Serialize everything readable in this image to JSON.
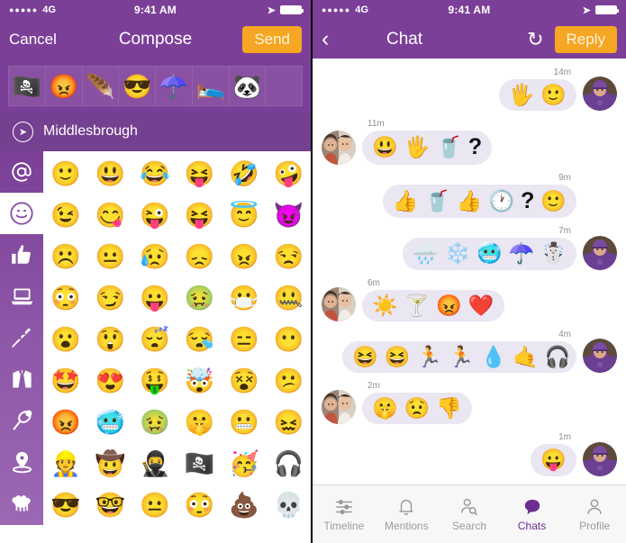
{
  "status_bar": {
    "signal_dots": "●●●●●",
    "carrier": "4G",
    "time": "9:41 AM",
    "location_icon": "location-arrow-icon",
    "battery_icon": "battery-full-icon"
  },
  "colors": {
    "brand_purple": "#7B3F98",
    "dark_purple": "#744090",
    "accent_orange": "#F5A623",
    "bubble": "#EAE6F2",
    "tab_active": "#6E2E91",
    "tab_inactive": "#9B9B9B"
  },
  "left_screen": {
    "nav": {
      "cancel_label": "Cancel",
      "title": "Compose",
      "send_label": "Send"
    },
    "compose_strip": {
      "emoji": [
        "🏴‍☠️",
        "😡",
        "🪶",
        "😎",
        "☂️",
        "🛌",
        "🐼",
        ""
      ],
      "names": [
        "pirate-face-emoji",
        "angry-face-emoji",
        "feather-emoji",
        "sunglasses-face-emoji",
        "umbrella-emoji",
        "person-in-bed-emoji",
        "panda-emoji",
        "empty-slot"
      ]
    },
    "location": {
      "icon": "navigation-arrow-icon",
      "name": "Middlesbrough"
    },
    "categories": [
      {
        "name": "recent-at-category",
        "icon": "at-icon",
        "glyph": "@",
        "active": false
      },
      {
        "name": "smileys-category",
        "icon": "heart-eyes-smiley-icon",
        "glyph": "☺",
        "active": true
      },
      {
        "name": "gestures-category",
        "icon": "thumbs-up-icon",
        "glyph": "👍",
        "active": false
      },
      {
        "name": "objects-category",
        "icon": "laptop-icon",
        "glyph": "💻",
        "active": false
      },
      {
        "name": "food-category",
        "icon": "pizza-icon",
        "glyph": "🍕",
        "active": false
      },
      {
        "name": "clothing-category",
        "icon": "shirt-icon",
        "glyph": "👕",
        "active": false
      },
      {
        "name": "sports-category",
        "icon": "tennis-racket-icon",
        "glyph": "🎾",
        "active": false
      },
      {
        "name": "places-category",
        "icon": "map-pin-icon",
        "glyph": "📍",
        "active": false
      },
      {
        "name": "animals-category",
        "icon": "sheep-icon",
        "glyph": "🐑",
        "active": false
      }
    ],
    "emoji_grid": [
      {
        "g": "🙂",
        "n": "slightly-smiling-face-emoji"
      },
      {
        "g": "😃",
        "n": "grinning-face-emoji"
      },
      {
        "g": "😂",
        "n": "tears-of-joy-emoji"
      },
      {
        "g": "😝",
        "n": "squinting-tongue-emoji"
      },
      {
        "g": "🤣",
        "n": "rolling-on-floor-laughing-emoji"
      },
      {
        "g": "🤪",
        "n": "wavy-mouth-face-emoji"
      },
      {
        "g": "😉",
        "n": "winking-face-emoji"
      },
      {
        "g": "😋",
        "n": "tongue-out-face-emoji"
      },
      {
        "g": "😜",
        "n": "winking-tongue-face-emoji"
      },
      {
        "g": "😝",
        "n": "closed-eyes-tongue-emoji"
      },
      {
        "g": "😇",
        "n": "halo-angel-face-emoji"
      },
      {
        "g": "😈",
        "n": "devil-horns-face-emoji"
      },
      {
        "g": "☹️",
        "n": "frowning-face-emoji"
      },
      {
        "g": "😐",
        "n": "neutral-face-emoji"
      },
      {
        "g": "😥",
        "n": "sad-tear-face-emoji"
      },
      {
        "g": "😞",
        "n": "disappointed-face-emoji"
      },
      {
        "g": "😠",
        "n": "angry-face-emoji"
      },
      {
        "g": "😒",
        "n": "unamused-face-emoji"
      },
      {
        "g": "😳",
        "n": "flushed-face-emoji"
      },
      {
        "g": "😏",
        "n": "smirking-drool-face-emoji"
      },
      {
        "g": "😛",
        "n": "tongue-sticking-out-emoji"
      },
      {
        "g": "🤢",
        "n": "vomiting-face-emoji"
      },
      {
        "g": "😷",
        "n": "face-with-medical-mask-emoji"
      },
      {
        "g": "🤐",
        "n": "zipper-mouth-face-emoji"
      },
      {
        "g": "😮",
        "n": "open-mouth-face-emoji"
      },
      {
        "g": "😲",
        "n": "astonished-face-emoji"
      },
      {
        "g": "😴",
        "n": "sleeping-face-emoji"
      },
      {
        "g": "😪",
        "n": "sleepy-face-emoji"
      },
      {
        "g": "😑",
        "n": "expressionless-face-emoji"
      },
      {
        "g": "😶",
        "n": "no-mouth-face-emoji"
      },
      {
        "g": "🤩",
        "n": "star-struck-face-emoji"
      },
      {
        "g": "😍",
        "n": "heart-eyes-face-emoji"
      },
      {
        "g": "🤑",
        "n": "money-mouth-face-emoji"
      },
      {
        "g": "🤯",
        "n": "mind-blown-face-emoji"
      },
      {
        "g": "😵",
        "n": "dizzy-face-emoji"
      },
      {
        "g": "😕",
        "n": "confused-face-emoji"
      },
      {
        "g": "😡",
        "n": "red-angry-face-emoji"
      },
      {
        "g": "🥶",
        "n": "cold-face-emoji"
      },
      {
        "g": "🤢",
        "n": "green-sick-face-emoji"
      },
      {
        "g": "🤫",
        "n": "shushing-face-emoji"
      },
      {
        "g": "😬",
        "n": "grimacing-face-emoji"
      },
      {
        "g": "😖",
        "n": "confounded-face-emoji"
      },
      {
        "g": "👷",
        "n": "construction-worker-emoji"
      },
      {
        "g": "🤠",
        "n": "cowboy-hat-face-emoji"
      },
      {
        "g": "🥷",
        "n": "ninja-emoji"
      },
      {
        "g": "🏴‍☠️",
        "n": "pirate-face-emoji"
      },
      {
        "g": "🥳",
        "n": "party-face-emoji"
      },
      {
        "g": "🎧",
        "n": "headphones-face-emoji"
      },
      {
        "g": "😎",
        "n": "sunglasses-face-emoji"
      },
      {
        "g": "🤓",
        "n": "nerd-face-emoji"
      },
      {
        "g": "😐",
        "n": "blank-face-emoji"
      },
      {
        "g": "😳",
        "n": "blushing-face-emoji"
      },
      {
        "g": "💩",
        "n": "pile-of-poo-emoji"
      },
      {
        "g": "💀",
        "n": "skull-emoji"
      }
    ]
  },
  "right_screen": {
    "nav": {
      "back_icon": "chevron-left-icon",
      "title": "Chat",
      "refresh_icon": "refresh-icon",
      "reply_label": "Reply"
    },
    "messages": [
      {
        "side": "right",
        "time": "14m",
        "avatar": "avatar-man-purple-cap",
        "emoji": [
          "🖐️",
          "🙂"
        ],
        "names": [
          "raised-hand-emoji",
          "smiling-face-emoji"
        ]
      },
      {
        "side": "left",
        "time": "11m",
        "avatar": "avatar-two-women",
        "emoji": [
          "😃",
          "🖐️",
          "🥤",
          "?"
        ],
        "names": [
          "grinning-face-emoji",
          "raised-hand-emoji",
          "drink-cup-emoji",
          "question-mark"
        ]
      },
      {
        "side": "right",
        "time": "9m",
        "avatar": null,
        "emoji": [
          "👍",
          "🥤",
          "👍",
          "🕐",
          "?",
          "🙂"
        ],
        "names": [
          "thumbs-up-emoji",
          "drink-cup-emoji",
          "thumbs-up-emoji",
          "clock-emoji",
          "question-mark",
          "smiling-face-emoji"
        ]
      },
      {
        "side": "right",
        "time": "7m",
        "avatar": "avatar-man-purple-cap",
        "emoji": [
          "🌧️",
          "❄️",
          "🥶",
          "☂️",
          "☃️"
        ],
        "names": [
          "rain-cloud-emoji",
          "snowflake-emoji",
          "cold-face-emoji",
          "umbrella-emoji",
          "snowman-emoji"
        ]
      },
      {
        "side": "left",
        "time": "6m",
        "avatar": "avatar-two-women",
        "emoji": [
          "☀️",
          "🍸",
          "😡",
          "❤️"
        ],
        "names": [
          "sun-emoji",
          "cocktail-emoji",
          "red-angry-face-emoji",
          "red-heart-emoji"
        ]
      },
      {
        "side": "right",
        "time": "4m",
        "avatar": "avatar-man-purple-cap",
        "emoji": [
          "😆",
          "😆",
          "🏃",
          "🏃",
          "💧",
          "🤙",
          "🎧"
        ],
        "names": [
          "laughing-face-emoji",
          "laughing-face-emoji",
          "treadmill-emoji",
          "running-person-emoji",
          "water-bottle-emoji",
          "call-me-hand-emoji",
          "headphones-face-emoji"
        ]
      },
      {
        "side": "left",
        "time": "2m",
        "avatar": "avatar-two-women",
        "emoji": [
          "🤫",
          "😟",
          "👎"
        ],
        "names": [
          "shushing-face-emoji",
          "sad-face-emoji",
          "thumbs-down-emoji"
        ]
      },
      {
        "side": "right",
        "time": "1m",
        "avatar": "avatar-man-purple-cap",
        "emoji": [
          "😛"
        ],
        "names": [
          "tongue-out-face-emoji"
        ]
      }
    ],
    "tabs": [
      {
        "label": "Timeline",
        "icon": "sliders-icon",
        "active": false
      },
      {
        "label": "Mentions",
        "icon": "bell-icon",
        "active": false
      },
      {
        "label": "Search",
        "icon": "person-search-icon",
        "active": false
      },
      {
        "label": "Chats",
        "icon": "speech-bubble-icon",
        "active": true
      },
      {
        "label": "Profile",
        "icon": "person-icon",
        "active": false
      }
    ]
  }
}
